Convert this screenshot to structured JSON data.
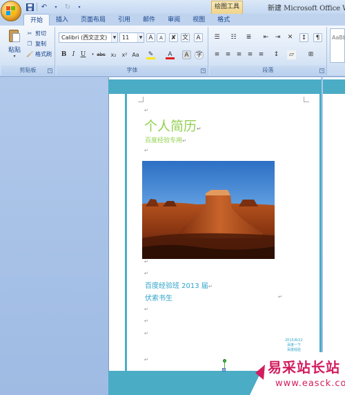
{
  "title_bar": {
    "context_tab": "绘图工具",
    "window_title": "新建 Microsoft Office Word"
  },
  "ribbon": {
    "tabs": [
      "开始",
      "插入",
      "页面布局",
      "引用",
      "邮件",
      "审阅",
      "视图",
      "格式"
    ],
    "active_tab": "开始",
    "clipboard": {
      "label": "剪贴板",
      "paste": "粘贴",
      "cut": "剪切",
      "copy": "复制",
      "format_painter": "格式刷"
    },
    "font": {
      "label": "字体",
      "font_name": "Calibri (西文正文)",
      "font_size": "11"
    },
    "paragraph": {
      "label": "段落"
    },
    "styles_preview": "AaBb"
  },
  "document": {
    "title": "个人简历",
    "subtitle": "百度经验专用",
    "line1": "百度经验班 2013 届",
    "line2": "伏索书生",
    "date_text": "2015/8/22",
    "date_sub1": "百度一下",
    "date_sub2": "百度经验"
  },
  "watermark": {
    "site_name": "易采站长站",
    "url": "www.easck.com"
  },
  "colors": {
    "accent_teal": "#4bacc6",
    "title_green": "#92d050",
    "text_blue": "#2ea3c9",
    "watermark_red": "#d21d5f"
  }
}
